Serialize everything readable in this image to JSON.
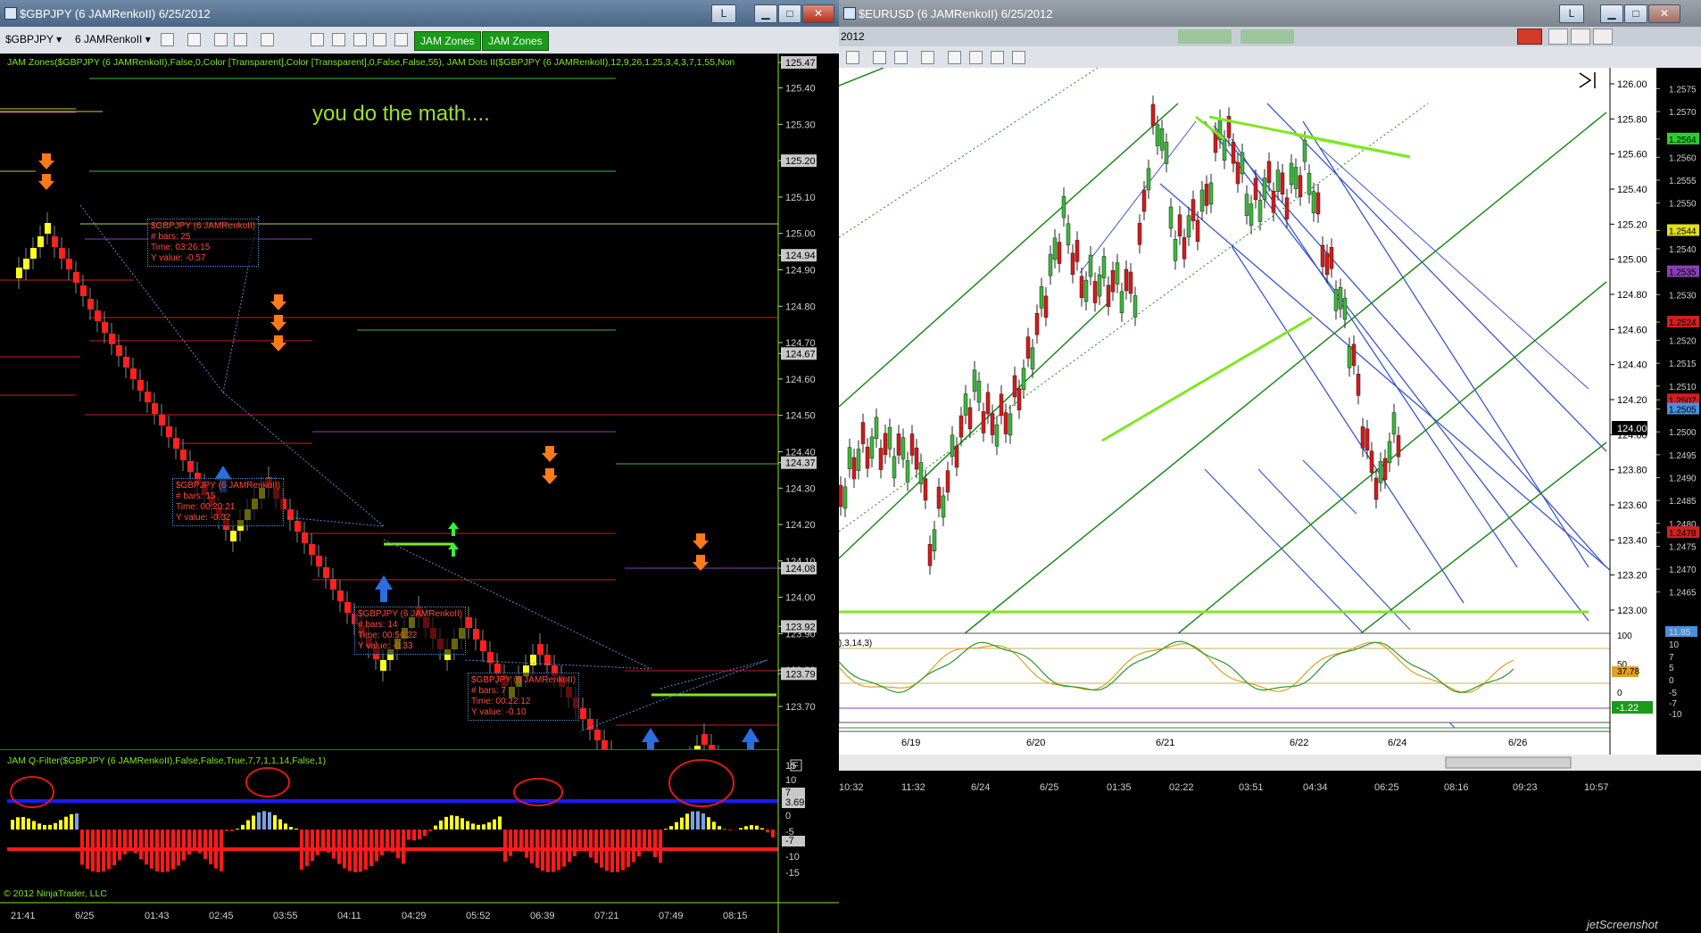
{
  "left_window": {
    "title": "$GBPJPY (6 JAMRenkoII)  6/25/2012",
    "instrument": "$GBPJPY",
    "bar_type": "6 JAMRenkoII",
    "toolbar_buttons": [
      "JAM Zones",
      "JAM Zones"
    ],
    "min_btn": "L",
    "indicator_label": "JAM Zones($GBPJPY (6 JAMRenkoII),False,0,Color [Transparent],Color [Transparent],0,False,False,55),  JAM Dots II($GBPJPY (6 JAMRenkoII),12,9,26,1.25,3,4,3,7,1,55,Non",
    "annotation": "you do the math....",
    "price_ticks": [
      "125.47",
      "125.40",
      "125.30",
      "125.20",
      "125.10",
      "125.00",
      "124.94",
      "124.90",
      "124.80",
      "124.70",
      "124.67",
      "124.60",
      "124.50",
      "124.40",
      "124.37",
      "124.30",
      "124.20",
      "124.10",
      "124.08",
      "124.00",
      "123.92",
      "123.90",
      "123.80",
      "123.79",
      "123.70"
    ],
    "stat_boxes": [
      {
        "title": "$GBPJPY (6 JAMRenkoII)",
        "bars": "# bars:   25",
        "time": "Time:    03:26:15",
        "yval": "Y value: -0.57"
      },
      {
        "title": "$GBPJPY (6 JAMRenkoII)",
        "bars": "# bars:   15",
        "time": "Time:    00:20:21",
        "yval": "Y value: -0.32"
      },
      {
        "title": "$GBPJPY (6 JAMRenkoII)",
        "bars": "# bars:   14",
        "time": "Time:    00:56:22",
        "yval": "Y value: -0.33"
      },
      {
        "title": "$GBPJPY (6 JAMRenkoII)",
        "bars": "# bars:   7",
        "time": "Time:    00:22:12",
        "yval": "Y value: -0.10"
      }
    ],
    "qfilter_label": "JAM Q-Filter($GBPJPY (6 JAMRenkoII),False,False,True,7,7,1,1,14,False,1)",
    "qfilter_ticks": [
      "15",
      "10",
      "7",
      "3.69",
      "0",
      "-5",
      "-7",
      "-10",
      "-15"
    ],
    "time_ticks": [
      "21:41",
      "6/25",
      "01:43",
      "02:45",
      "03:55",
      "04:11",
      "04:29",
      "05:52",
      "06:39",
      "07:21",
      "07:49",
      "08:15"
    ],
    "copyright": "© 2012 NinjaTrader, LLC",
    "panel_f": "F"
  },
  "right_window": {
    "title": "$EURUSD (6 JAMRenkoII)  6/25/2012",
    "inner_title": "2012",
    "min_btn": "L",
    "price_ticks": [
      "126.00",
      "125.80",
      "125.60",
      "125.40",
      "125.20",
      "125.00",
      "124.80",
      "124.60",
      "124.40",
      "124.20",
      "124.00",
      "123.80",
      "123.60",
      "123.40",
      "123.20",
      "123.00"
    ],
    "current_price": "124.00",
    "far_ticks": [
      "1.2575",
      "1.2570",
      "1.2564",
      "1.2560",
      "1.2555",
      "1.2550",
      "1.2544",
      "1.2540",
      "1.2535",
      "1.2530",
      "1.2524",
      "1.2520",
      "1.2515",
      "1.2510",
      "1.2507",
      "1.2505",
      "1.2500",
      "1.2495",
      "1.2490",
      "1.2485",
      "1.2480",
      "1.2478",
      "1.2475",
      "1.2470",
      "1.2465"
    ],
    "osc_label": "),3,14,3)",
    "osc_ticks": [
      "100",
      "50",
      "37.78",
      "0"
    ],
    "osc_value": "-1.22",
    "far_osc_ticks": [
      "11.85",
      "10",
      "7",
      "5",
      "0",
      "-5",
      "-7",
      "-10"
    ],
    "date_ticks": [
      "6/19",
      "6/20",
      "6/21",
      "6/22",
      "6/24",
      "6/26"
    ],
    "time_ticks": [
      "10:32",
      "11:32",
      "6/24",
      "6/25",
      "01:35",
      "02:22",
      "03:51",
      "04:34",
      "06:25",
      "08:16",
      "09:23",
      "10:57"
    ],
    "watermark": "jetScreenshot"
  },
  "colors": {
    "bear": "#ff2020",
    "bull": "#ffff1a",
    "accent": "#7fe81f",
    "pitchfork_blue": "#3c58c8",
    "pitchfork_green": "#1c8a1c"
  }
}
